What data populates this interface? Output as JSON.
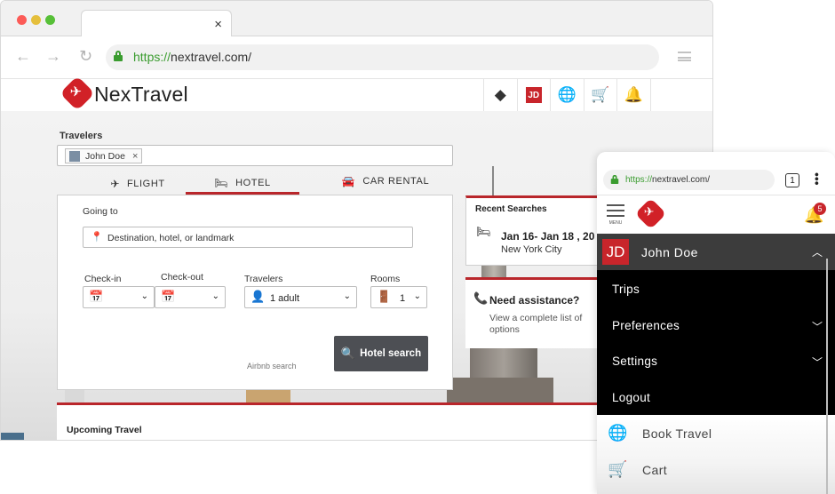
{
  "desktop": {
    "url_scheme": "https://",
    "url_rest": "nextravel.com/",
    "tab_close": "×",
    "brand": "NexTravel",
    "header_icons": [
      {
        "name": "tag-icon",
        "glyph": "◆"
      },
      {
        "name": "user-badge",
        "glyph": "JD"
      },
      {
        "name": "globe-icon",
        "glyph": "⊕"
      },
      {
        "name": "cart-icon",
        "glyph": "🛒"
      },
      {
        "name": "bell-icon",
        "glyph": "🔔"
      }
    ],
    "travelers_label": "Travelers",
    "traveler_chip": "John Doe",
    "chip_remove": "×",
    "tabs": {
      "flight": "FLIGHT",
      "hotel": "HOTEL",
      "car": "CAR RENTAL"
    },
    "going_to_label": "Going to",
    "destination_placeholder": "Destination, hotel, or landmark",
    "checkin_label": "Check-in",
    "checkout_label": "Check-out",
    "travelers_field_label": "Travelers",
    "travelers_value": "1 adult",
    "rooms_label": "Rooms",
    "rooms_value": "1",
    "airbnb_label": "Airbnb search",
    "search_button": "Hotel search",
    "recent_title": "Recent Searches",
    "recent_dates": "Jan 16- Jan 18 , 20",
    "recent_city": "New York City",
    "assist_title": "Need assistance?",
    "assist_text": "View a complete list of options",
    "upcoming_title": "Upcoming Travel"
  },
  "mobile": {
    "url_scheme": "https://",
    "url_rest": "nextravel.com/",
    "tab_count": "1",
    "menu_caption": "MENU",
    "notification_count": "5",
    "user_initials": "JD",
    "user_name": "John Doe",
    "menu_items": [
      "Trips",
      "Preferences",
      "Settings",
      "Logout"
    ],
    "light_items": [
      "Book Travel",
      "Cart"
    ]
  },
  "colors": {
    "accent": "#b9262b",
    "brand_red": "#d12127",
    "secure_green": "#3a9c2f"
  }
}
